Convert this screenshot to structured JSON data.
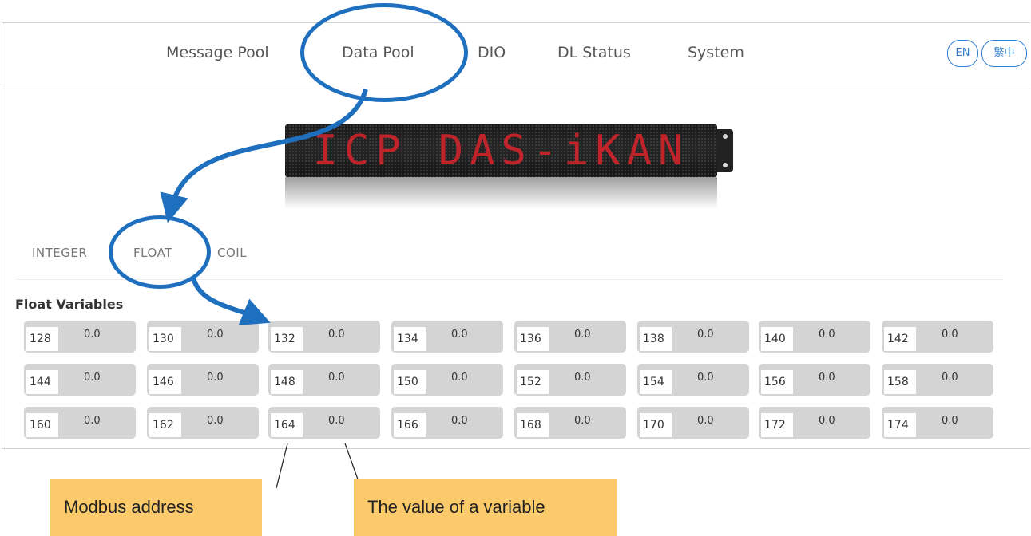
{
  "nav": {
    "items": [
      "Message Pool",
      "Data Pool",
      "DIO",
      "DL Status",
      "System"
    ],
    "lang_en": "EN",
    "lang_zh": "繁中"
  },
  "banner": {
    "text": "ICP DAS-iKAN"
  },
  "tabs": [
    "INTEGER",
    "FLOAT",
    "COIL"
  ],
  "section": {
    "title": "Float Variables"
  },
  "variables": [
    [
      {
        "addr": "128",
        "val": "0.0"
      },
      {
        "addr": "130",
        "val": "0.0"
      },
      {
        "addr": "132",
        "val": "0.0"
      },
      {
        "addr": "134",
        "val": "0.0"
      },
      {
        "addr": "136",
        "val": "0.0"
      },
      {
        "addr": "138",
        "val": "0.0"
      },
      {
        "addr": "140",
        "val": "0.0"
      },
      {
        "addr": "142",
        "val": "0.0"
      }
    ],
    [
      {
        "addr": "144",
        "val": "0.0"
      },
      {
        "addr": "146",
        "val": "0.0"
      },
      {
        "addr": "148",
        "val": "0.0"
      },
      {
        "addr": "150",
        "val": "0.0"
      },
      {
        "addr": "152",
        "val": "0.0"
      },
      {
        "addr": "154",
        "val": "0.0"
      },
      {
        "addr": "156",
        "val": "0.0"
      },
      {
        "addr": "158",
        "val": "0.0"
      }
    ],
    [
      {
        "addr": "160",
        "val": "0.0"
      },
      {
        "addr": "162",
        "val": "0.0"
      },
      {
        "addr": "164",
        "val": "0.0"
      },
      {
        "addr": "166",
        "val": "0.0"
      },
      {
        "addr": "168",
        "val": "0.0"
      },
      {
        "addr": "170",
        "val": "0.0"
      },
      {
        "addr": "172",
        "val": "0.0"
      },
      {
        "addr": "174",
        "val": "0.0"
      }
    ]
  ],
  "callouts": {
    "address": "Modbus address",
    "value": "The value of a variable"
  },
  "colors": {
    "accent": "#1f6fbf",
    "callout_bg": "#fbcb6b",
    "led_red": "#c0242b",
    "cell_bg": "#d4d4d4"
  }
}
